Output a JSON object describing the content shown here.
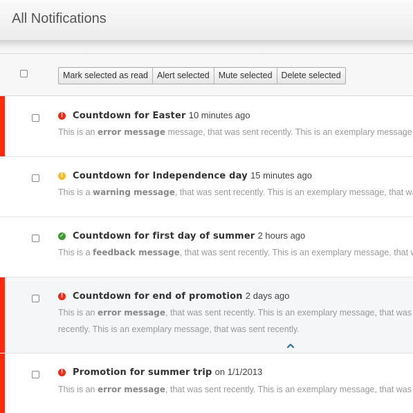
{
  "header": {
    "title": "All Notifications"
  },
  "toolbar": {
    "mark_read": "Mark selected as read",
    "alert": "Alert selected",
    "mute": "Mute selected",
    "delete": "Delete selected"
  },
  "colors": {
    "error": "#f02a10",
    "warning": "#f5bd1d",
    "success": "#3a9d2a",
    "accent": "#ff2a0a",
    "collapse": "#2f6faa"
  },
  "notifications": [
    {
      "subject": "Countdown for Easter",
      "time": "10 minutes ago",
      "status": "error",
      "msg_prefix": "This is an ",
      "kind": "error message",
      "msg_suffix": " message, that was sent recently. This is an exemplary message, th",
      "expanded_line": ""
    },
    {
      "subject": "Countdown for Independence day",
      "time": "15 minutes ago",
      "status": "warning",
      "msg_prefix": "This is a ",
      "kind": "warning message",
      "msg_suffix": ", that was sent recently. This is an exemplary message, that was s",
      "expanded_line": ""
    },
    {
      "subject": "Countdown for first day of summer",
      "time": "2 hours ago",
      "status": "success",
      "msg_prefix": "This is a ",
      "kind": "feedback message",
      "msg_suffix": ", that was sent recently. This is an exemplary message, that was s",
      "expanded_line": ""
    },
    {
      "subject": "Countdown for end of promotion",
      "time": "2 days ago",
      "status": "error",
      "msg_prefix": "This is an ",
      "kind": "error message",
      "msg_suffix": ", that was sent recently. This is an exemplary message, that was se",
      "expanded_line": "recently. This is an exemplary message, that was sent recently."
    },
    {
      "subject": "Promotion for summer trip",
      "time": "on 1/1/2013",
      "status": "error",
      "msg_prefix": "This is an ",
      "kind": "error message",
      "msg_suffix": ", that was sent recently. This is an exemplary message, that was se",
      "expanded_line": ""
    }
  ]
}
